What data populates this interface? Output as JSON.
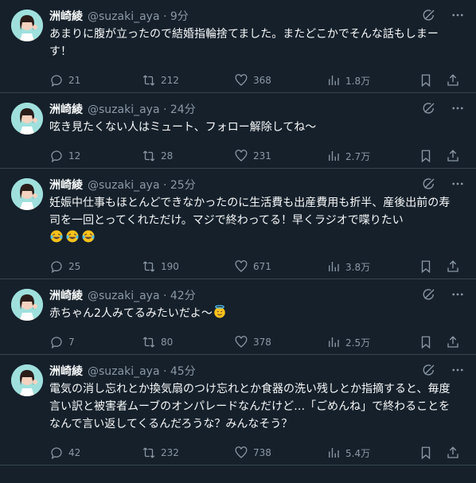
{
  "tweets": [
    {
      "name": "洲崎綾",
      "handle": "@suzaki_aya",
      "time": "9分",
      "text": "あまりに腹が立ったので結婚指輪捨てました。またどこかでそんな話もしまーす！",
      "replies": "21",
      "retweets": "212",
      "likes": "368",
      "views": "1.8万",
      "emojis": 0
    },
    {
      "name": "洲崎綾",
      "handle": "@suzaki_aya",
      "time": "24分",
      "text": "呟き見たくない人はミュート、フォロー解除してね〜",
      "replies": "12",
      "retweets": "28",
      "likes": "231",
      "views": "2.7万",
      "emojis": 0
    },
    {
      "name": "洲崎綾",
      "handle": "@suzaki_aya",
      "time": "25分",
      "text": "妊娠中仕事もほとんどできなかったのに生活費も出産費用も折半、産後出前の寿司を一回とってくれただけ。マジで終わってる！早くラジオで喋りたい",
      "replies": "25",
      "retweets": "190",
      "likes": "671",
      "views": "3.8万",
      "emojis": 3
    },
    {
      "name": "洲崎綾",
      "handle": "@suzaki_aya",
      "time": "42分",
      "text": "赤ちゃん2人みてるみたいだよ〜",
      "replies": "7",
      "retweets": "80",
      "likes": "378",
      "views": "2.5万",
      "emojis": 0
    },
    {
      "name": "洲崎綾",
      "handle": "@suzaki_aya",
      "time": "45分",
      "text": "電気の消し忘れとか換気扇のつけ忘れとか食器の洗い残しとか指摘すると、毎度言い訳と被害者ムーブのオンパレードなんだけど…「ごめんね」で終わることをなんで言い返してくるんだろうな？みんなそう？",
      "replies": "42",
      "retweets": "232",
      "likes": "738",
      "views": "5.4万",
      "emojis": 0
    }
  ],
  "icons": {
    "grok": "grok-icon",
    "more": "more-icon",
    "reply": "reply-icon",
    "retweet": "retweet-icon",
    "like": "like-icon",
    "views": "views-icon",
    "bookmark": "bookmark-icon",
    "share": "share-icon",
    "laugh_emoji": "rolling-laughing-emoji",
    "halo_emoji": "smiling-halo-emoji"
  },
  "colors": {
    "background": "#15202b",
    "text": "#f7f9f9",
    "muted": "#8b98a5",
    "divider": "#38444d"
  }
}
